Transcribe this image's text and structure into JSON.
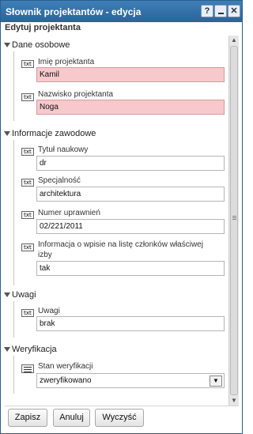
{
  "window": {
    "title": "Słownik projektantów - edycja",
    "help_btn": "?",
    "close_btn": "✕"
  },
  "header": {
    "title": "Edytuj projektanta"
  },
  "sections": {
    "personal": {
      "title": "Dane osobowe",
      "first_name": {
        "label": "Imię projektanta",
        "value": "Kamil"
      },
      "last_name": {
        "label": "Nazwisko projektanta",
        "value": "Noga"
      }
    },
    "professional": {
      "title": "Informacje zawodowe",
      "degree": {
        "label": "Tytuł naukowy",
        "value": "dr"
      },
      "specialty": {
        "label": "Specjalność",
        "value": "architektura"
      },
      "license": {
        "label": "Numer uprawnień",
        "value": "02/221/2011"
      },
      "chamber": {
        "label_line1": "Informacja o wpisie na listę członków właściwej",
        "label_line2": "izby",
        "value": "tak"
      }
    },
    "notes": {
      "title": "Uwagi",
      "notes_field": {
        "label": "Uwagi",
        "value": "brak"
      }
    },
    "verification": {
      "title": "Weryfikacja",
      "status": {
        "label": "Stan weryfikacji",
        "value": "zweryfikowano"
      }
    }
  },
  "icons": {
    "txt": "txt"
  },
  "buttons": {
    "save": "Zapisz",
    "cancel": "Anuluj",
    "clear": "Wyczyść"
  }
}
